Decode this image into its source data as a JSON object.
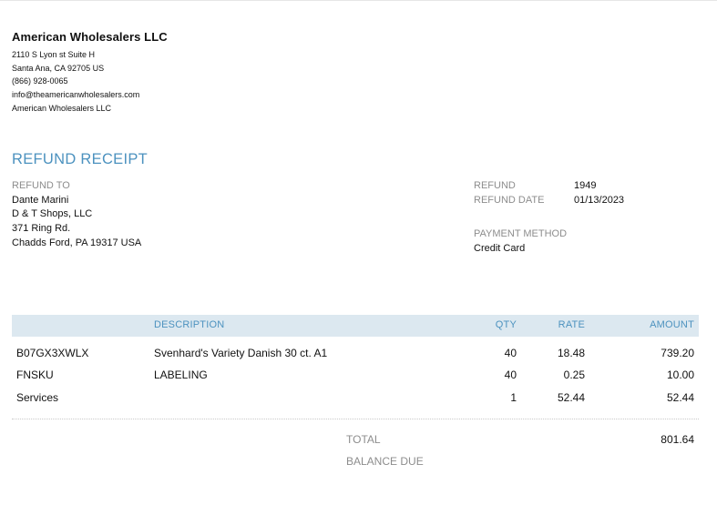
{
  "company": {
    "name": "American Wholesalers LLC",
    "lines": [
      "2110 S Lyon st Suite H",
      "Santa Ana, CA  92705 US",
      "(866) 928-0065",
      "info@theamericanwholesalers.com",
      "American Wholesalers LLC"
    ]
  },
  "title": "REFUND RECEIPT",
  "refund_to": {
    "label": "REFUND TO",
    "lines": [
      "Dante Marini",
      "D & T Shops, LLC",
      "371 Ring Rd.",
      "Chadds Ford, PA  19317 USA"
    ]
  },
  "meta": {
    "refund_label": "REFUND",
    "refund_value": "1949",
    "date_label": "REFUND DATE",
    "date_value": "01/13/2023",
    "payment_label": "PAYMENT METHOD",
    "payment_value": "Credit Card"
  },
  "table": {
    "headers": {
      "description": "DESCRIPTION",
      "qty": "QTY",
      "rate": "RATE",
      "amount": "AMOUNT"
    },
    "rows": [
      {
        "sku": "B07GX3XWLX",
        "description": "Svenhard's Variety Danish 30 ct. A1",
        "qty": "40",
        "rate": "18.48",
        "amount": "739.20"
      },
      {
        "sku": "FNSKU",
        "description": "LABELING",
        "qty": "40",
        "rate": "0.25",
        "amount": "10.00"
      },
      {
        "sku": "Services",
        "description": "",
        "qty": "1",
        "rate": "52.44",
        "amount": "52.44"
      }
    ]
  },
  "totals": {
    "total_label": "TOTAL",
    "total_value": "801.64",
    "balance_label": "BALANCE DUE"
  }
}
